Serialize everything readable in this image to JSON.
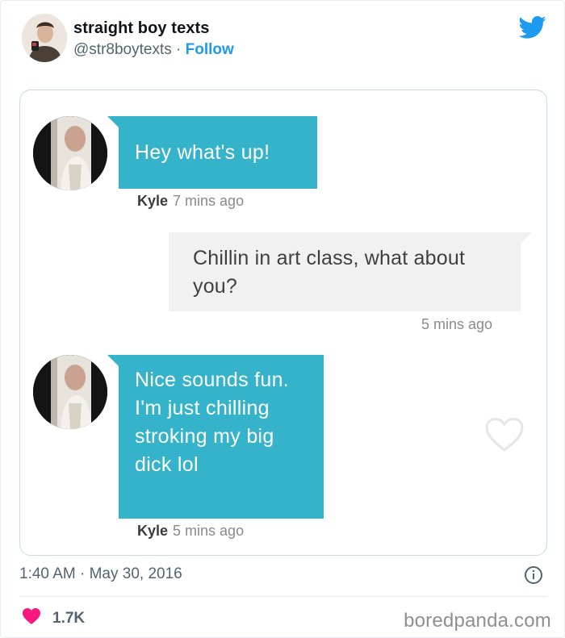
{
  "author": {
    "display_name": "straight boy texts",
    "handle": "@str8boytexts",
    "separator": "·",
    "follow_label": "Follow"
  },
  "icons": {
    "brand": "twitter-logo-icon",
    "like": "heart-icon",
    "info": "info-icon",
    "like_outline": "heart-outline-icon"
  },
  "colors": {
    "twitter_blue": "#1d9bf0",
    "incoming_bubble": "#35b3cb",
    "outgoing_bubble": "#f1f1f1",
    "like_pink": "#f91880"
  },
  "conversation": {
    "messages": [
      {
        "direction": "incoming",
        "text": "Hey what's up!",
        "sender": "Kyle",
        "time": "7 mins ago"
      },
      {
        "direction": "outgoing",
        "text": "Chillin in art class, what about you?",
        "time": "5 mins ago"
      },
      {
        "direction": "incoming",
        "text": "Nice sounds fun. I'm just chilling stroking my big dick lol",
        "sender": "Kyle",
        "time": "5 mins ago"
      }
    ]
  },
  "tweet": {
    "timestamp": "1:40 AM · May 30, 2016",
    "likes": "1.7K"
  },
  "watermark": "boredpanda.com"
}
